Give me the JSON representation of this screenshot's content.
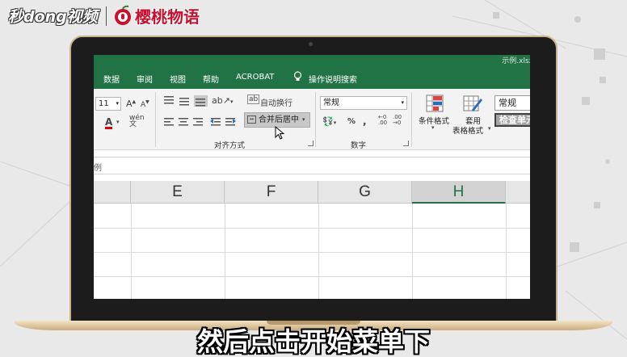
{
  "watermark": {
    "left_logo": "秒dong视频",
    "right_logo": "樱桃物语"
  },
  "excel": {
    "filename": "示例.xlsx",
    "tabs": [
      "数据",
      "审阅",
      "视图",
      "帮助",
      "ACROBAT"
    ],
    "tell_me": "操作说明搜索",
    "font_size": "11",
    "wrap_text": "自动换行",
    "merge_center": "合并后居中",
    "alignment_group": "对齐方式",
    "number_format": "常规",
    "number_group": "数字",
    "conditional_format": "条件格式",
    "table_format_line1": "套用",
    "table_format_line2": "表格格式",
    "style_normal": "常规",
    "style_check": "检查单元",
    "formula_fragment": "例",
    "columns": [
      "E",
      "F",
      "G",
      "H"
    ],
    "selected_column": "H",
    "colors": {
      "excel_green": "#217346"
    }
  },
  "subtitle": "然后点击开始菜单下"
}
